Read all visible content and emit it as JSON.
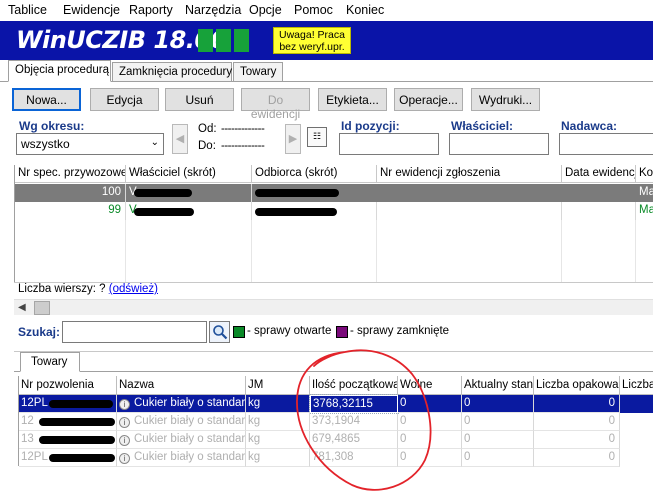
{
  "menu": [
    "Tablice",
    "Ewidencje",
    "Raporty",
    "Narzędzia",
    "Opcje",
    "Pomoc",
    "Koniec"
  ],
  "header": {
    "app_title": "WinUCZIB 18.00",
    "warning_line1": "Uwaga! Praca",
    "warning_line2": "bez weryf.upr."
  },
  "tabs": [
    "Objęcia procedurą",
    "Zamknięcia procedury",
    "Towary"
  ],
  "toolbar": {
    "new": "Nowa...",
    "edit": "Edycja",
    "delete": "Usuń",
    "to_register": "Do ewidencji",
    "label": "Etykieta...",
    "operations": "Operacje...",
    "prints": "Wydruki..."
  },
  "filters": {
    "period_label": "Wg okresu:",
    "period_value": "wszystko",
    "from_label": "Od:",
    "from_value": "-------------",
    "to_label": "Do:",
    "to_value": "-------------",
    "position_id_label": "Id pozycji:",
    "owner_label": "Właściciel:",
    "sender_label": "Nadawca:"
  },
  "main_grid": {
    "columns": [
      "Nr spec. przywozowej",
      "Właściciel (skrót)",
      "Odbiorca (skrót)",
      "Nr ewidencji zgłoszenia",
      "Data ewidencji",
      "Kon"
    ],
    "rows": [
      {
        "nr": "100",
        "owner": "V",
        "recipient": "",
        "nr_ew": "",
        "date": "",
        "kon": "Ma",
        "selected": true
      },
      {
        "nr": "99",
        "owner": "V",
        "recipient": "",
        "nr_ew": "",
        "date": "",
        "kon": "Ma",
        "selected": false
      }
    ]
  },
  "rows_info": {
    "label": "Liczba wierszy:",
    "count": "?",
    "refresh": "(odśwież)"
  },
  "search": {
    "label": "Szukaj:",
    "legend_open": "- sprawy otwarte",
    "legend_closed": "- sprawy zamknięte",
    "open_color": "#0a8a28",
    "closed_color": "#7a0a7a"
  },
  "bottom_tabs": [
    "Towary"
  ],
  "goods_grid": {
    "columns": [
      "Nr pozwolenia",
      "Nazwa",
      "JM",
      "Ilość początkowa",
      "Wolne",
      "Aktualny stan",
      "Liczba opakowań",
      "Liczba"
    ],
    "rows": [
      {
        "permit": "12PL",
        "name": "Cukier biały o standard",
        "jm": "kg",
        "qty": "3768,32115",
        "free": "0",
        "state": "0",
        "packages": "0"
      },
      {
        "permit": "12",
        "name": "Cukier biały o standard",
        "jm": "kg",
        "qty": "373,1904",
        "free": "0",
        "state": "0",
        "packages": "0"
      },
      {
        "permit": "13",
        "name": "Cukier biały o standard",
        "jm": "kg",
        "qty": "679,4865",
        "free": "0",
        "state": "0",
        "packages": "0"
      },
      {
        "permit": "12PL",
        "name": "Cukier biały o standard",
        "jm": "kg",
        "qty": "781,308",
        "free": "0",
        "state": "0",
        "packages": "0"
      }
    ]
  }
}
